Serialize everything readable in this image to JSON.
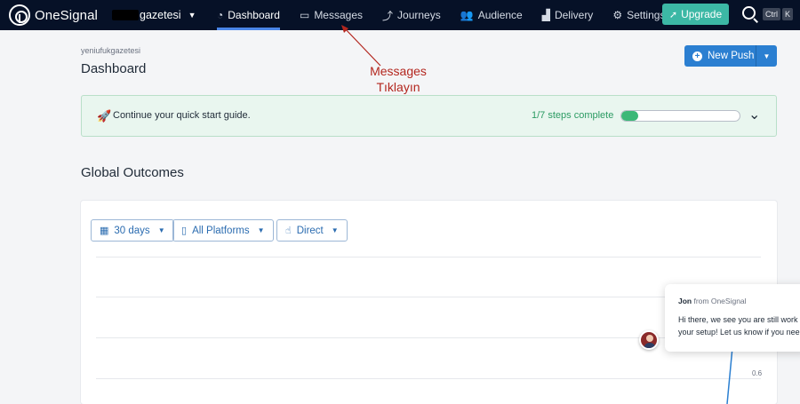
{
  "topnav": {
    "logo_text": "OneSignal",
    "app_name": "gazetesi",
    "items": [
      {
        "label": "Dashboard",
        "icon": "dashboard-icon",
        "active": true
      },
      {
        "label": "Messages",
        "icon": "chat-icon"
      },
      {
        "label": "Journeys",
        "icon": "journey-icon"
      },
      {
        "label": "Audience",
        "icon": "users-icon"
      },
      {
        "label": "Delivery",
        "icon": "chart-icon"
      },
      {
        "label": "Settings",
        "icon": "gear-icon"
      }
    ],
    "upgrade_label": "Upgrade",
    "kbd_ctrl": "Ctrl",
    "kbd_k": "K"
  },
  "header": {
    "breadcrumb": "yeniufukgazetesi",
    "title": "Dashboard",
    "new_push_label": "New Push"
  },
  "annotation": {
    "line1": "Messages",
    "line2": "Tıklayın",
    "color": "#b3261e"
  },
  "quickstart": {
    "text": "Continue your quick start guide.",
    "steps_text": "1/7 steps complete",
    "progress": 0.14
  },
  "outcomes": {
    "title": "Global Outcomes",
    "filters": [
      {
        "label": "30 days",
        "icon": "calendar-icon"
      },
      {
        "label": "All Platforms",
        "icon": "device-icon"
      },
      {
        "label": "Direct",
        "icon": "tap-icon"
      }
    ],
    "tick_label": "0.6"
  },
  "chat": {
    "from_name": "Jon",
    "from_rest": " from OneSignal",
    "line1": "Hi there, we see you are still work",
    "line2": "your setup! Let us know if you nee"
  },
  "colors": {
    "nav_bg": "#061127",
    "accent_blue": "#2b7fd1",
    "upgrade": "#3cb8a5",
    "progress_green": "#3cb878"
  }
}
